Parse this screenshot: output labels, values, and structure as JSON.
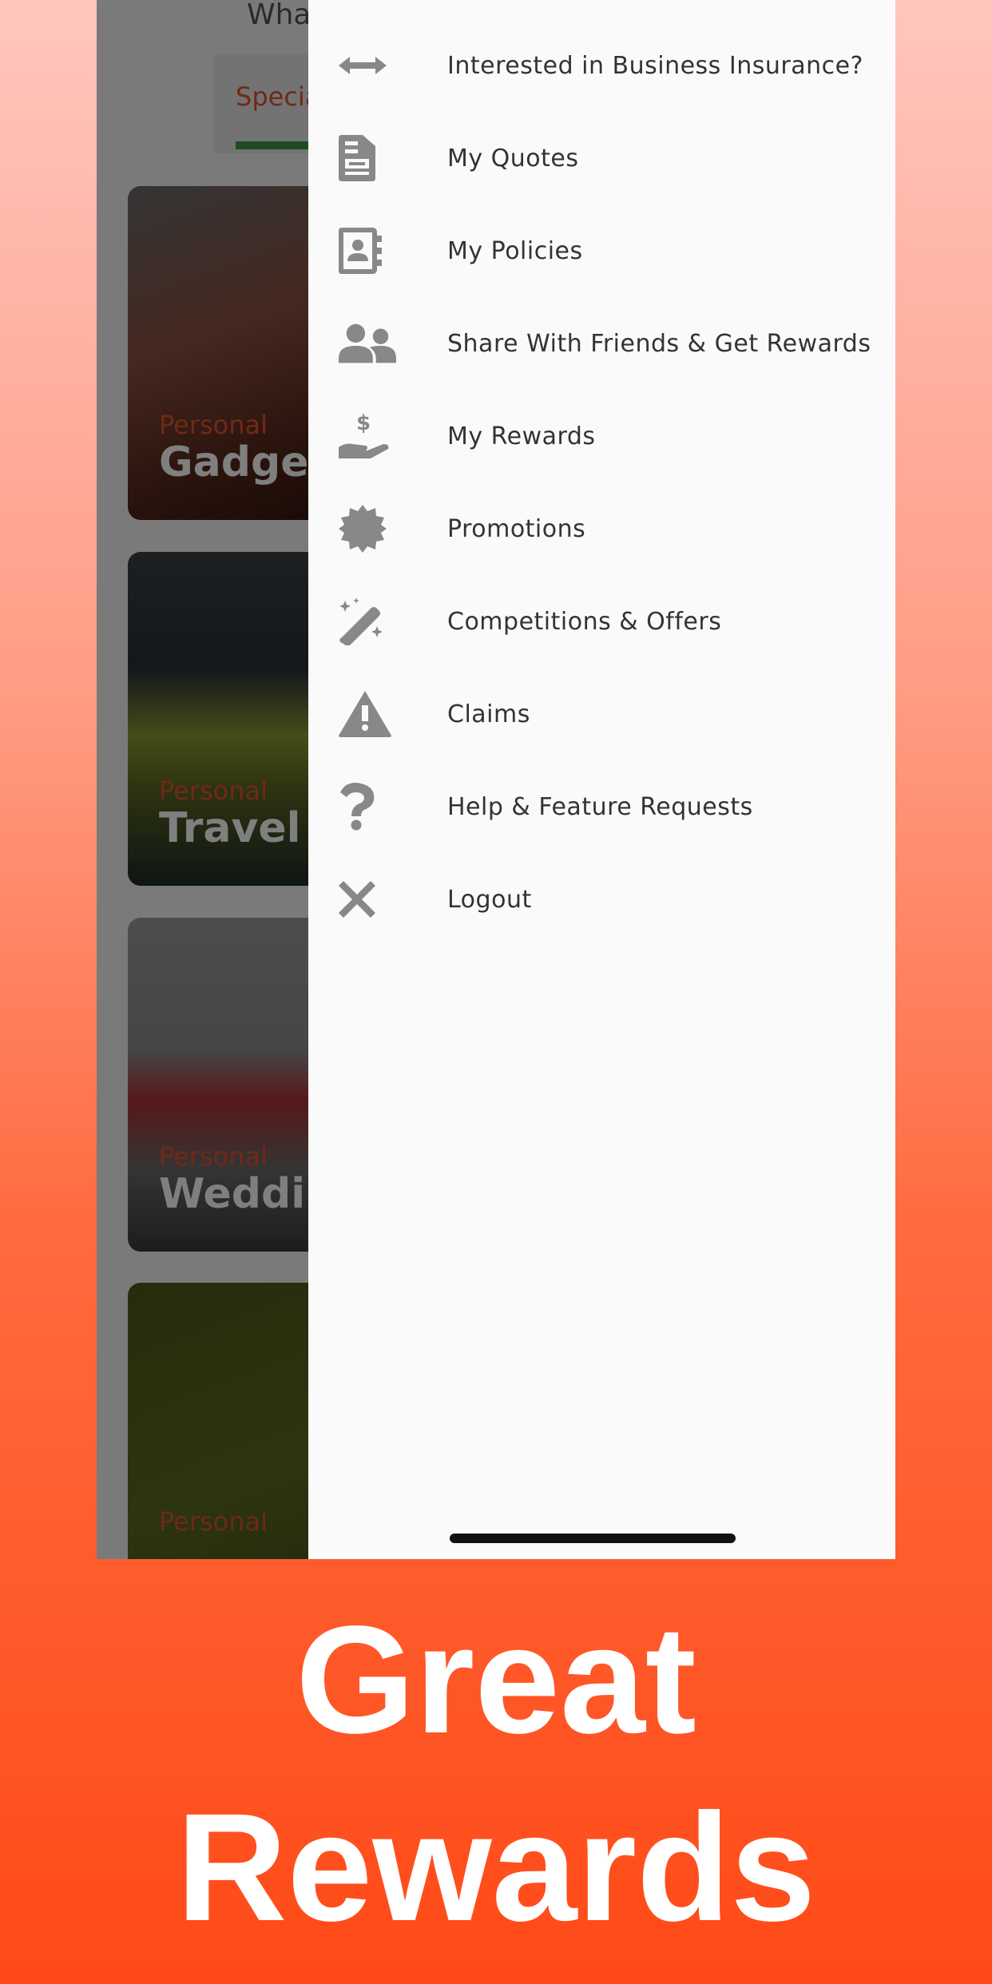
{
  "background_screen": {
    "heading_partial": "What",
    "tab_label_partial": "Specia",
    "cards": [
      {
        "category": "Personal",
        "title": "Gadget"
      },
      {
        "category": "Personal",
        "title": "Travel In"
      },
      {
        "category": "Personal",
        "title": "Wedding"
      },
      {
        "category": "Personal",
        "title": ""
      }
    ]
  },
  "drawer": {
    "items": [
      {
        "label": "Interested in Business Insurance?",
        "icon": "arrows-horizontal-icon"
      },
      {
        "label": "My Quotes",
        "icon": "document-icon"
      },
      {
        "label": "My Policies",
        "icon": "contact-book-icon"
      },
      {
        "label": "Share With Friends & Get Rewards",
        "icon": "users-icon"
      },
      {
        "label": "My Rewards",
        "icon": "hand-dollar-icon"
      },
      {
        "label": "Promotions",
        "icon": "badge-burst-icon"
      },
      {
        "label": "Competitions & Offers",
        "icon": "magic-wand-icon"
      },
      {
        "label": "Claims",
        "icon": "warning-triangle-icon"
      },
      {
        "label": "Help & Feature Requests",
        "icon": "question-icon"
      },
      {
        "label": "Logout",
        "icon": "close-icon"
      }
    ]
  },
  "headline": {
    "line1": "Great",
    "line2": "Rewards"
  },
  "colors": {
    "accent": "#e2522a",
    "tab_indicator": "#3a9a40",
    "icon": "#888888",
    "drawer_bg": "#fafafa"
  }
}
